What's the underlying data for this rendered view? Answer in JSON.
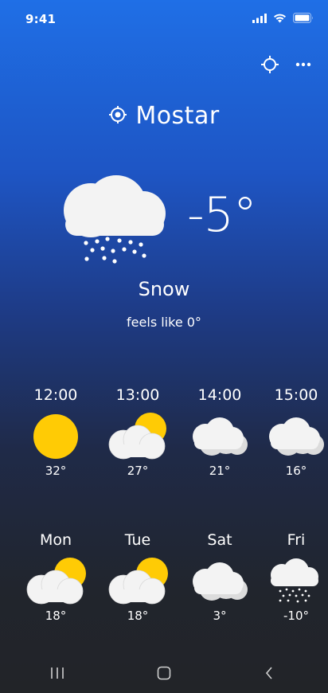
{
  "status_bar": {
    "time": "9:41",
    "icons": [
      "cellular-signal-icon",
      "wifi-icon",
      "battery-icon"
    ]
  },
  "header": {
    "actions": [
      "locate-icon",
      "more-options-icon"
    ]
  },
  "location": {
    "name": "Mostar",
    "icon": "location-pin-icon"
  },
  "current": {
    "temperature": "-5°",
    "condition": "Snow",
    "feels_like": "feels like 0°",
    "icon": "snow-cloud-icon"
  },
  "hourly": [
    {
      "time": "12:00",
      "temp": "32°",
      "icon": "sunny-icon"
    },
    {
      "time": "13:00",
      "temp": "27°",
      "icon": "partly-cloudy-icon"
    },
    {
      "time": "14:00",
      "temp": "21°",
      "icon": "cloudy-icon"
    },
    {
      "time": "15:00",
      "temp": "16°",
      "icon": "cloudy-icon"
    }
  ],
  "daily": [
    {
      "day": "Mon",
      "temp": "18°",
      "icon": "partly-cloudy-icon"
    },
    {
      "day": "Tue",
      "temp": "18°",
      "icon": "partly-cloudy-icon"
    },
    {
      "day": "Sat",
      "temp": "3°",
      "icon": "cloudy-icon"
    },
    {
      "day": "Fri",
      "temp": "-10°",
      "icon": "snow-cloud-icon"
    }
  ],
  "nav_bar": {
    "buttons": [
      "recent-apps-icon",
      "home-icon",
      "back-icon"
    ]
  },
  "colors": {
    "gradient_top": "#1f6fe6",
    "gradient_bottom": "#222428",
    "sun": "#ffcb05",
    "cloud": "#f3f3f3"
  }
}
